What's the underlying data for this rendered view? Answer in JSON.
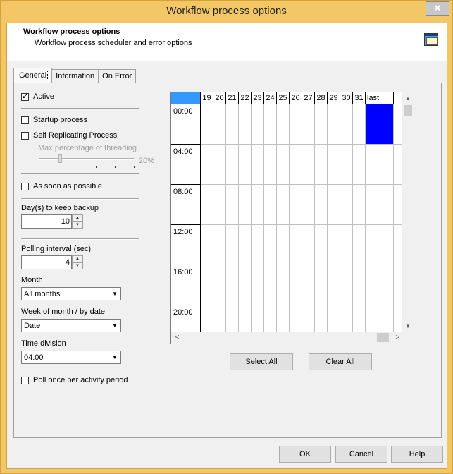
{
  "window": {
    "title": "Workflow process options",
    "close_label": "✕"
  },
  "header": {
    "title": "Workflow process options",
    "subtitle": "Workflow process scheduler and error options",
    "icon": "window-app-icon"
  },
  "tabs": [
    {
      "label": "General",
      "active": true
    },
    {
      "label": "Information",
      "active": false
    },
    {
      "label": "On Error",
      "active": false
    }
  ],
  "general": {
    "active_label": "Active",
    "active_checked": true,
    "startup_label": "Startup process",
    "startup_checked": false,
    "self_replicating_label": "Self Replicating Process",
    "self_replicating_checked": false,
    "threading_label": "Max percentage of threading",
    "threading_value": "20%",
    "asap_label": "As soon as possible",
    "asap_checked": false,
    "backup_label": "Day(s) to keep backup",
    "backup_value": "10",
    "polling_label": "Polling interval (sec)",
    "polling_value": "4",
    "month_label": "Month",
    "month_value": "All months",
    "week_label": "Week of month / by date",
    "week_value": "Date",
    "time_division_label": "Time division",
    "time_division_value": "04:00",
    "poll_once_label": "Poll once per activity period",
    "poll_once_checked": false
  },
  "schedule": {
    "columns": [
      "19",
      "20",
      "21",
      "22",
      "23",
      "24",
      "25",
      "26",
      "27",
      "28",
      "29",
      "30",
      "31",
      "last"
    ],
    "rows": [
      "00:00",
      "04:00",
      "08:00",
      "12:00",
      "16:00",
      "20:00"
    ],
    "selected": [
      {
        "row": "00:00",
        "column": "last"
      }
    ],
    "select_color": "#0000ff",
    "corner_color": "#3399ff"
  },
  "buttons": {
    "select_all": "Select All",
    "clear_all": "Clear All",
    "ok": "OK",
    "cancel": "Cancel",
    "help": "Help"
  }
}
